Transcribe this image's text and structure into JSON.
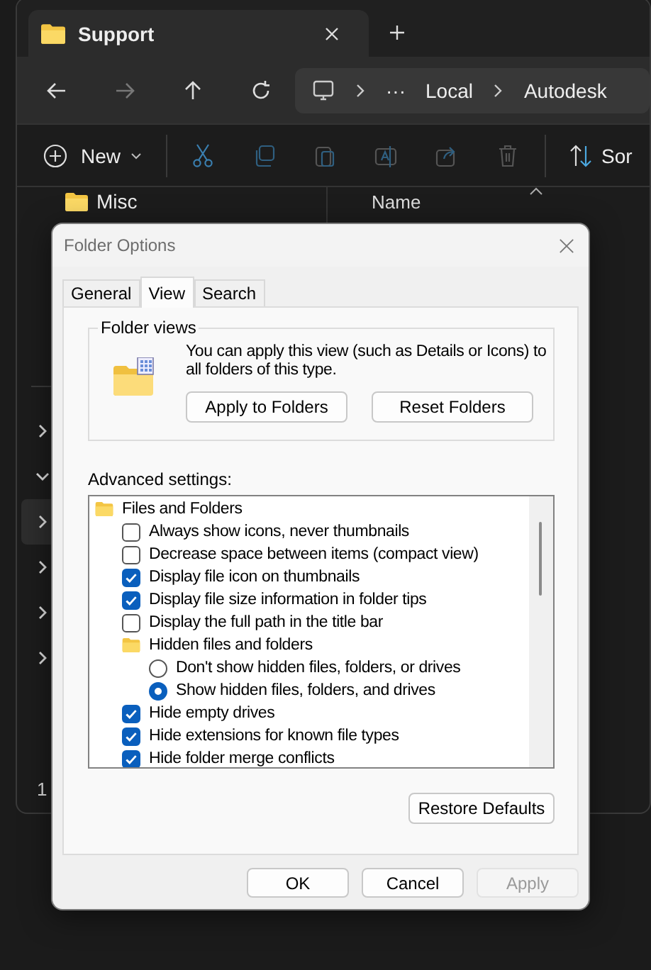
{
  "explorer": {
    "tab": {
      "title": "Support"
    },
    "address": {
      "overflow": "···",
      "path": [
        "Local",
        "Autodesk"
      ]
    },
    "command_bar": {
      "new": "New",
      "sort": "Sor"
    },
    "sidebar": {
      "top_item": "Misc",
      "rows": [
        {
          "expanded": false,
          "selected": false
        },
        {
          "expanded": true,
          "selected": false
        },
        {
          "expanded": false,
          "selected": true
        },
        {
          "expanded": false,
          "selected": false
        },
        {
          "expanded": false,
          "selected": false
        },
        {
          "expanded": false,
          "selected": false
        }
      ]
    },
    "column_header": "Name",
    "status_bar": "1"
  },
  "dialog": {
    "title": "Folder Options",
    "tabs": [
      {
        "label": "General",
        "selected": false
      },
      {
        "label": "View",
        "selected": true
      },
      {
        "label": "Search",
        "selected": false
      }
    ],
    "folder_views": {
      "legend": "Folder views",
      "description": "You can apply this view (such as Details or Icons) to all folders of this type.",
      "buttons": [
        "Apply to Folders",
        "Reset Folders"
      ]
    },
    "advanced_label": "Advanced settings:",
    "settings": [
      {
        "kind": "group",
        "label": "Files and Folders",
        "children": [
          {
            "kind": "checkbox",
            "label": "Always show icons, never thumbnails",
            "checked": false
          },
          {
            "kind": "checkbox",
            "label": "Decrease space between items (compact view)",
            "checked": false
          },
          {
            "kind": "checkbox",
            "label": "Display file icon on thumbnails",
            "checked": true
          },
          {
            "kind": "checkbox",
            "label": "Display file size information in folder tips",
            "checked": true
          },
          {
            "kind": "checkbox",
            "label": "Display the full path in the title bar",
            "checked": false
          },
          {
            "kind": "group",
            "label": "Hidden files and folders",
            "children": [
              {
                "kind": "radio",
                "label": "Don't show hidden files, folders, or drives",
                "selected": false
              },
              {
                "kind": "radio",
                "label": "Show hidden files, folders, and drives",
                "selected": true
              }
            ]
          },
          {
            "kind": "checkbox",
            "label": "Hide empty drives",
            "checked": true
          },
          {
            "kind": "checkbox",
            "label": "Hide extensions for known file types",
            "checked": true
          },
          {
            "kind": "checkbox",
            "label": "Hide folder merge conflicts",
            "checked": true
          }
        ]
      }
    ],
    "restore_button": "Restore Defaults",
    "buttons": [
      {
        "label": "OK",
        "disabled": false
      },
      {
        "label": "Cancel",
        "disabled": false
      },
      {
        "label": "Apply",
        "disabled": true
      }
    ]
  }
}
